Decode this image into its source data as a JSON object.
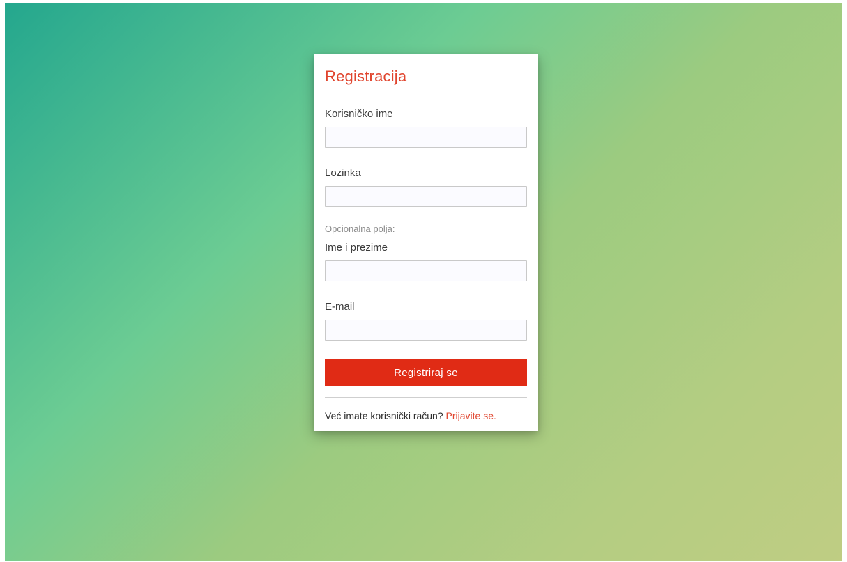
{
  "colors": {
    "accent": "#e0442d",
    "button": "#e02b15",
    "gradient_start": "#24a78e",
    "gradient_end": "#bfcd83"
  },
  "form": {
    "title": "Registracija",
    "fields": {
      "username_label": "Korisničko ime",
      "username_value": "",
      "password_label": "Lozinka",
      "password_value": "",
      "optional_note": "Opcionalna polja:",
      "fullname_label": "Ime i prezime",
      "fullname_value": "",
      "email_label": "E-mail",
      "email_value": ""
    },
    "submit_label": "Registriraj se",
    "footer_text": "Već imate korisnički račun?",
    "login_link": "Prijavite se."
  }
}
